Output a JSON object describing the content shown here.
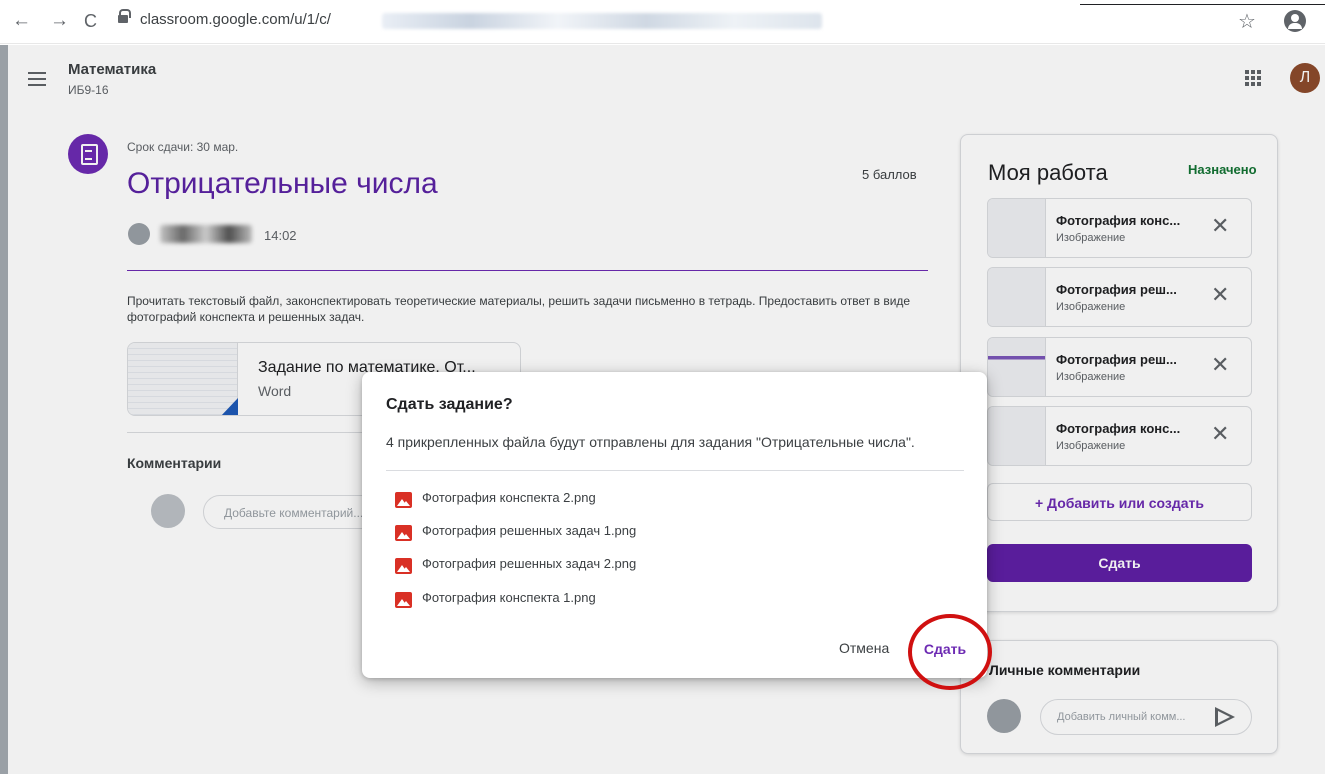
{
  "browser": {
    "url": "classroom.google.com/u/1/c/"
  },
  "header": {
    "course_title": "Математика",
    "course_subtitle": "ИБ9-16",
    "avatar_letter": "Л"
  },
  "assignment": {
    "due": "Срок сдачи: 30 мар.",
    "title": "Отрицательные числа",
    "points": "5 баллов",
    "time": "14:02",
    "description": "Прочитать текстовый файл, законспектировать теоретические материалы, решить задачи письменно в тетрадь. Предоставить ответ в виде фотографий конспекта и решенных задач.",
    "attachment": {
      "name": "Задание по математике. От...",
      "type": "Word"
    },
    "comments_label": "Комментарии",
    "comment_placeholder": "Добавьте комментарий..."
  },
  "my_work": {
    "title": "Моя работа",
    "status": "Назначено",
    "status_color": "#137333",
    "files": [
      {
        "name": "Фотография конс...",
        "type": "Изображение"
      },
      {
        "name": "Фотография реш...",
        "type": "Изображение"
      },
      {
        "name": "Фотография реш...",
        "type": "Изображение"
      },
      {
        "name": "Фотография конс...",
        "type": "Изображение"
      }
    ],
    "add_label": "+ Добавить или создать",
    "submit_label": "Сдать",
    "submit_color": "#5f1fa5"
  },
  "private_comments": {
    "title": "Личные комментарии",
    "placeholder": "Добавить личный комм..."
  },
  "modal": {
    "title": "Сдать задание?",
    "message": "4 прикрепленных файла будут отправлены для задания \"Отрицательные числа\".",
    "files": [
      "Фотография конспекта 2.png",
      "Фотография решенных задач 1.png",
      "Фотография решенных задач 2.png",
      "Фотография конспекта 1.png"
    ],
    "cancel_label": "Отмена",
    "confirm_label": "Сдать"
  },
  "icons": {
    "back": "arrow-left-icon",
    "forward": "arrow-right-icon",
    "reload": "reload-icon",
    "lock": "lock-icon",
    "bookmark": "star-icon",
    "account": "account-icon",
    "menu": "kebab-icon",
    "apps": "apps-grid-icon",
    "assignment": "assignment-icon",
    "remove": "close-icon",
    "image": "image-file-icon",
    "send": "send-icon"
  }
}
